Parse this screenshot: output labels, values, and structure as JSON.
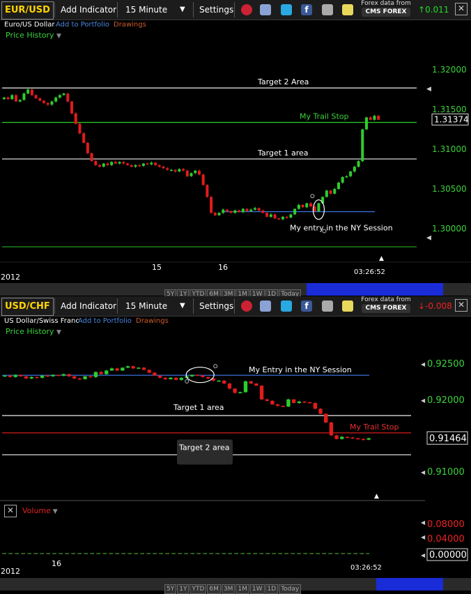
{
  "colors": {
    "up": "#2ecc2e",
    "down": "#e01c1c",
    "accent": "#ffd400",
    "green_text": "#3cd23c",
    "trail_green": "#27c427",
    "entry_blue": "#3a6fd8",
    "trail_red": "#d81c1c",
    "scroll_blue": "#1a2bd8"
  },
  "toolbar": {
    "add_indicator": "Add Indicator",
    "settings": "Settings",
    "forex_data_from": "Forex data from",
    "cms_forex": "CMS FOREX"
  },
  "panels": [
    {
      "symbol": "EUR/USD",
      "name": "Euro/US Dollar",
      "add_portfolio": "Add to Portfolio",
      "drawings": "Drawings",
      "price_history": "Price History",
      "interval": "15 Minute",
      "change": "0.011",
      "change_dir": "up",
      "current_price": "1.31374",
      "year": "2012",
      "time": "03:26:52",
      "xticks": [
        "15",
        "16"
      ],
      "yticks": [
        "1.32000",
        "1.31500",
        "1.31000",
        "1.30500",
        "1.30000"
      ]
    },
    {
      "symbol": "USD/CHF",
      "name": "US Dollar/Swiss Franc",
      "add_portfolio": "Add to Portfolio",
      "drawings": "Drawings",
      "price_history": "Price History",
      "interval": "15 Minute",
      "change": "-0.008",
      "change_dir": "down",
      "current_price": "0.91464",
      "year": "2012",
      "time": "03:26:52",
      "xticks": [
        "16"
      ],
      "yticks": [
        "0.92500",
        "0.92000",
        "0.91000"
      ],
      "volume_label": "Volume",
      "volume_ticks": [
        "0.08000",
        "0.04000"
      ],
      "volume_current": "0.00000"
    }
  ],
  "range_buttons": [
    "5Y",
    "1Y",
    "YTD",
    "6M",
    "3M",
    "1M",
    "1W",
    "1D",
    "Today"
  ],
  "chart_data": [
    {
      "type": "candlestick",
      "title": "EUR/USD",
      "ylim": [
        1.2965,
        1.3235
      ],
      "levels": [
        {
          "name": "Target 2 Area",
          "value": 1.3177
        },
        {
          "name": "My Trail Stop",
          "value": 1.31337
        },
        {
          "name": "Target 1 area",
          "value": 1.30877
        },
        {
          "name": "My entry in the NY Session",
          "value": 1.30215
        }
      ],
      "close": [
        1.3165,
        1.3163,
        1.3168,
        1.316,
        1.3162,
        1.317,
        1.3175,
        1.3168,
        1.3164,
        1.3161,
        1.3158,
        1.3156,
        1.316,
        1.3165,
        1.3168,
        1.317,
        1.316,
        1.3145,
        1.3132,
        1.312,
        1.3108,
        1.3095,
        1.3085,
        1.308,
        1.3078,
        1.3082,
        1.308,
        1.3084,
        1.3082,
        1.3084,
        1.3082,
        1.308,
        1.3078,
        1.308,
        1.3079,
        1.3082,
        1.3081,
        1.3083,
        1.308,
        1.3078,
        1.3076,
        1.3074,
        1.3074,
        1.3072,
        1.3075,
        1.3073,
        1.3066,
        1.307,
        1.3073,
        1.3068,
        1.3055,
        1.304,
        1.302,
        1.3017,
        1.302,
        1.3024,
        1.3022,
        1.302,
        1.3023,
        1.3021,
        1.3025,
        1.3022,
        1.3024,
        1.3026,
        1.3023,
        1.302,
        1.3015,
        1.3018,
        1.3013,
        1.3012,
        1.3015,
        1.3014,
        1.3018,
        1.3025,
        1.303,
        1.3027,
        1.3032,
        1.3028,
        1.3022,
        1.3032,
        1.304,
        1.3048,
        1.3044,
        1.305,
        1.3058,
        1.3065,
        1.3066,
        1.3072,
        1.3078,
        1.3085,
        1.3125,
        1.314,
        1.3137,
        1.3142,
        1.3137
      ]
    },
    {
      "type": "candlestick",
      "title": "USD/CHF",
      "ylim": [
        0.9075,
        0.9285
      ],
      "levels": [
        {
          "name": "My Entry in the NY Session",
          "value": 0.92335
        },
        {
          "name": "Target 1 area",
          "value": 0.91775
        },
        {
          "name": "My Trail Stop",
          "value": 0.91535
        },
        {
          "name": "Target 2 area",
          "value": 0.9123
        }
      ],
      "close": [
        0.9233,
        0.9231,
        0.9234,
        0.9232,
        0.9229,
        0.9231,
        0.923,
        0.9233,
        0.9232,
        0.9234,
        0.9233,
        0.9235,
        0.9232,
        0.9229,
        0.9228,
        0.9232,
        0.9231,
        0.9238,
        0.9235,
        0.924,
        0.9243,
        0.924,
        0.9244,
        0.9246,
        0.9243,
        0.9244,
        0.9241,
        0.9237,
        0.9233,
        0.923,
        0.9228,
        0.923,
        0.9227,
        0.923,
        0.9232,
        0.9234,
        0.9233,
        0.9231,
        0.9229,
        0.9226,
        0.9226,
        0.9222,
        0.9215,
        0.9209,
        0.921,
        0.9225,
        0.9222,
        0.9219,
        0.92,
        0.9198,
        0.9193,
        0.9191,
        0.919,
        0.92,
        0.9195,
        0.9197,
        0.9196,
        0.9195,
        0.9187,
        0.918,
        0.9168,
        0.915,
        0.9145,
        0.9148,
        0.9147,
        0.9146,
        0.9145,
        0.9144,
        0.9146
      ]
    }
  ]
}
